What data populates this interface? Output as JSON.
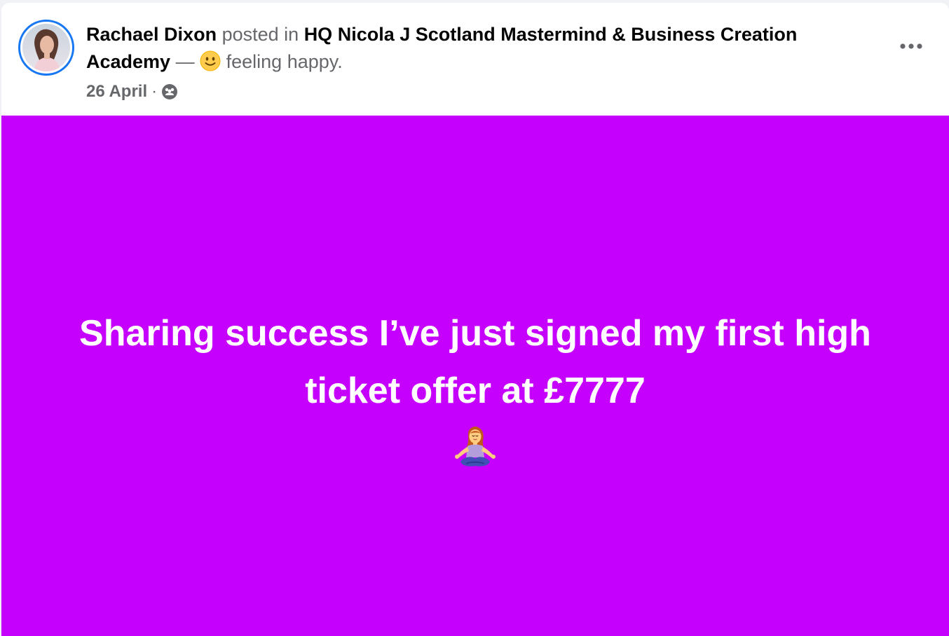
{
  "post": {
    "author": "Rachael Dixon",
    "posted_in_text": "posted in",
    "group_name": "HQ Nicola J Scotland Mastermind & Business Creation Academy",
    "dash": "—",
    "feeling_text": "feeling happy.",
    "date": "26 April",
    "separator": "·",
    "body_text": "Sharing success I’ve just signed my first high ticket offer at £7777",
    "background_color": "#c500fd",
    "feeling_icon": "slightly-smiling-face-emoji",
    "audience_icon": "group-members-icon",
    "body_emoji": "person-in-lotus-position-emoji"
  },
  "colors": {
    "accent": "#1877f2",
    "primary_text": "#050505",
    "secondary_text": "#65676b",
    "post_background": "#c500fd"
  }
}
